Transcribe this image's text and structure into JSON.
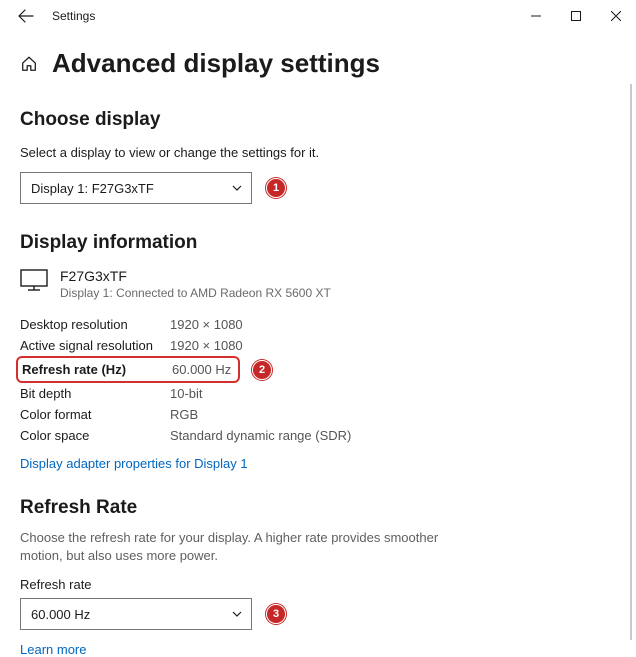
{
  "titlebar": {
    "app_title": "Settings"
  },
  "page": {
    "title": "Advanced display settings"
  },
  "choose_display": {
    "heading": "Choose display",
    "helper": "Select a display to view or change the settings for it.",
    "selected": "Display 1: F27G3xTF"
  },
  "display_info": {
    "heading": "Display information",
    "monitor_name": "F27G3xTF",
    "monitor_sub": "Display 1: Connected to AMD Radeon RX 5600 XT",
    "rows": {
      "desktop_res_label": "Desktop resolution",
      "desktop_res_value": "1920 × 1080",
      "active_res_label": "Active signal resolution",
      "active_res_value": "1920 × 1080",
      "refresh_label": "Refresh rate (Hz)",
      "refresh_value": "60.000 Hz",
      "bit_depth_label": "Bit depth",
      "bit_depth_value": "10-bit",
      "color_format_label": "Color format",
      "color_format_value": "RGB",
      "color_space_label": "Color space",
      "color_space_value": "Standard dynamic range (SDR)"
    },
    "adapter_link": "Display adapter properties for Display 1"
  },
  "refresh_rate": {
    "heading": "Refresh Rate",
    "helper": "Choose the refresh rate for your display. A higher rate provides smoother motion, but also uses more power.",
    "label": "Refresh rate",
    "selected": "60.000 Hz",
    "learn_more": "Learn more"
  },
  "callouts": {
    "one": "1",
    "two": "2",
    "three": "3"
  }
}
